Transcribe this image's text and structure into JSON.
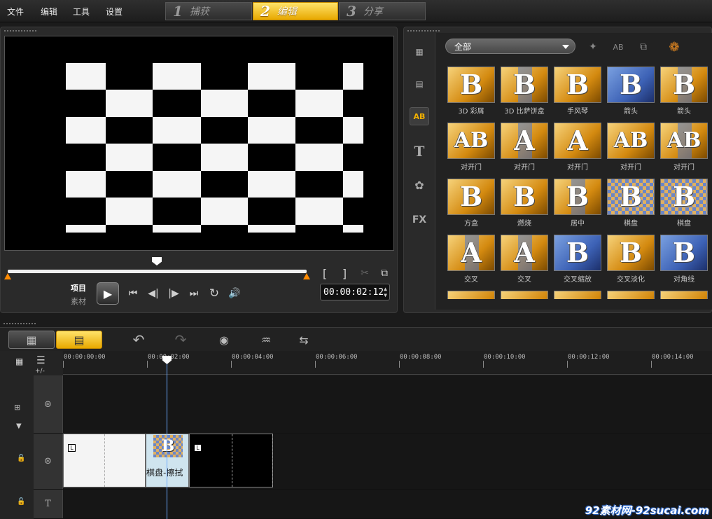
{
  "menu": [
    "文件",
    "编辑",
    "工具",
    "设置"
  ],
  "steps": [
    {
      "num": "1",
      "label": "捕获"
    },
    {
      "num": "2",
      "label": "编辑",
      "active": true
    },
    {
      "num": "3",
      "label": "分享"
    }
  ],
  "player": {
    "mode_project": "项目",
    "mode_clip": "素材",
    "timecode": "00:00:02:12",
    "mark_in": "[",
    "mark_out": "]"
  },
  "library": {
    "category": "全部",
    "side_icons": [
      "media-icon",
      "instant-project-icon",
      "transition-icon",
      "title-icon",
      "graphic-icon",
      "filter-icon"
    ],
    "transitions": [
      [
        "3D 彩屑",
        "3D 比萨饼盒",
        "手风琴",
        "箭头",
        "箭头"
      ],
      [
        "对开门",
        "对开门",
        "对开门",
        "对开门",
        "对开门"
      ],
      [
        "方盒",
        "燃烧",
        "居中",
        "棋盘",
        "棋盘"
      ],
      [
        "交叉",
        "交叉",
        "交叉缩放",
        "交叉淡化",
        "对角线"
      ]
    ]
  },
  "timeline": {
    "ruler": [
      "00:00:00:00",
      "00:00:02:00",
      "00:00:04:00",
      "00:00:06:00",
      "00:00:08:00",
      "00:00:10:00",
      "00:00:12:00",
      "00:00:14:00"
    ],
    "transition_clip_label": "棋盘-擦拭",
    "add_remove": "+/-"
  },
  "watermark": "92素材网-92sucai.com",
  "colors": {
    "accent": "#f0b400",
    "playhead": "#6aa8ff",
    "scrub_cap": "#ff8a00"
  }
}
